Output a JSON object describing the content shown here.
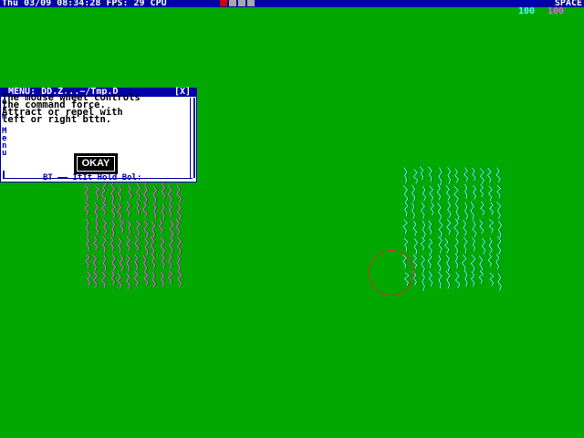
{
  "status_bar": {
    "clock_text": "Thu 03/09 08:34:28 FPS: 29 CPU",
    "space_label": "SPACE",
    "count_cyan": "100",
    "count_magenta": "100",
    "colors": {
      "bar": "#0000a8",
      "cpu_active": "#d00000",
      "cpu_idle": "#a8a8a8"
    }
  },
  "dialog": {
    "title": "MENU: DD.Z...~/Tmp.D",
    "close_label": "[X]",
    "message": "The mouse wheel controls\nthe command force.\nAttract or repel with\nleft or right bttn.",
    "side_menu": "P\ne\nr\nm\n\nM\ne\nn\nu",
    "bottom_text": "BT —— ItIt Hold Bol:",
    "okay_label": "OKAY"
  },
  "swarms": {
    "magenta": {
      "color": "#ff55ff",
      "count": "100"
    },
    "cyan": {
      "color": "#55ffff",
      "count": "100"
    }
  },
  "cursor": {
    "shape": "ring",
    "color": "#d03030"
  },
  "background": "#00a800"
}
